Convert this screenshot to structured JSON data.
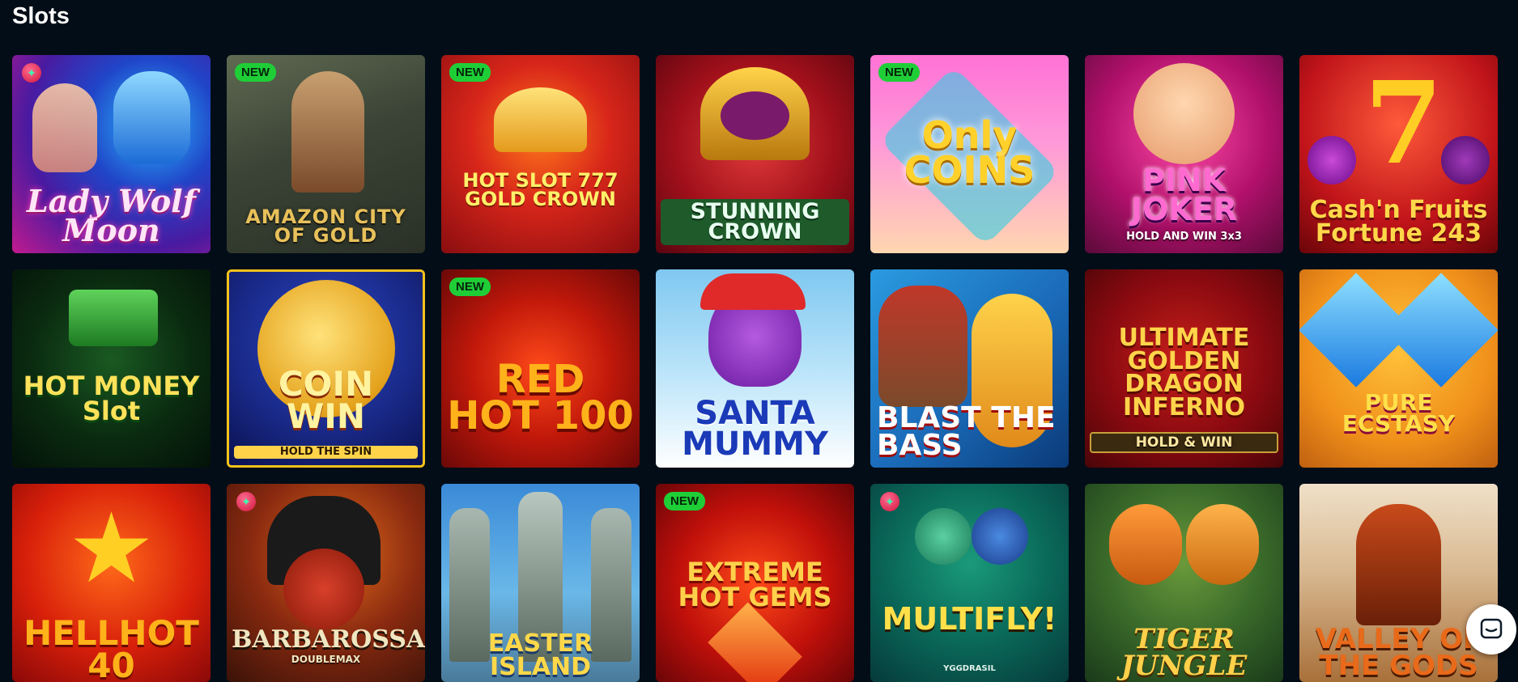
{
  "page": {
    "title": "Slots"
  },
  "games": [
    {
      "title": "Lady Wolf Moon",
      "badge": "",
      "provider_icon": "gem-icon"
    },
    {
      "title": "AMAZON CITY OF GOLD",
      "badge": "NEW",
      "provider_icon": ""
    },
    {
      "title": "HOT SLOT 777 GOLD CROWN",
      "badge": "NEW",
      "provider_icon": ""
    },
    {
      "title": "STUNNING CROWN",
      "badge": "",
      "provider_icon": ""
    },
    {
      "title": "Only COINS",
      "badge": "NEW",
      "provider_icon": ""
    },
    {
      "title": "PINK JOKER",
      "subtitle": "HOLD AND WIN 3x3",
      "badge": "",
      "provider_icon": ""
    },
    {
      "title": "Cash'n Fruits Fortune 243",
      "badge": "",
      "provider_icon": ""
    },
    {
      "title": "HOT MONEY Slot",
      "badge": "",
      "provider_icon": ""
    },
    {
      "title": "COIN WIN",
      "subtitle": "HOLD THE SPIN",
      "badge": "",
      "provider_icon": ""
    },
    {
      "title": "RED HOT 100",
      "badge": "NEW",
      "provider_icon": ""
    },
    {
      "title": "SANTA MUMMY",
      "badge": "",
      "provider_icon": ""
    },
    {
      "title": "BLAST THE BASS",
      "badge": "",
      "provider_icon": ""
    },
    {
      "title": "ULTIMATE GOLDEN DRAGON INFERNO",
      "subtitle": "HOLD & WIN",
      "badge": "",
      "provider_icon": ""
    },
    {
      "title": "PURE ECSTASY",
      "badge": "",
      "provider_icon": ""
    },
    {
      "title": "HELLHOT 40",
      "badge": "",
      "provider_icon": ""
    },
    {
      "title": "BARBAROSSA",
      "subtitle": "DOUBLEMAX",
      "badge": "",
      "provider_icon": "gem-icon"
    },
    {
      "title": "EASTER ISLAND",
      "badge": "",
      "provider_icon": ""
    },
    {
      "title": "EXTREME HOT GEMS",
      "badge": "NEW",
      "provider_icon": ""
    },
    {
      "title": "MULTIFLY!",
      "subtitle": "YGGDRASIL",
      "badge": "",
      "provider_icon": "gem-icon"
    },
    {
      "title": "TIGER JUNGLE",
      "badge": "",
      "provider_icon": ""
    },
    {
      "title": "VALLEY OF THE GODS",
      "badge": "",
      "provider_icon": ""
    }
  ],
  "chat": {
    "icon": "chat-icon"
  },
  "colors": {
    "background": "#030d17",
    "badge": "#1fce37",
    "highlight": "#f4c21a"
  }
}
